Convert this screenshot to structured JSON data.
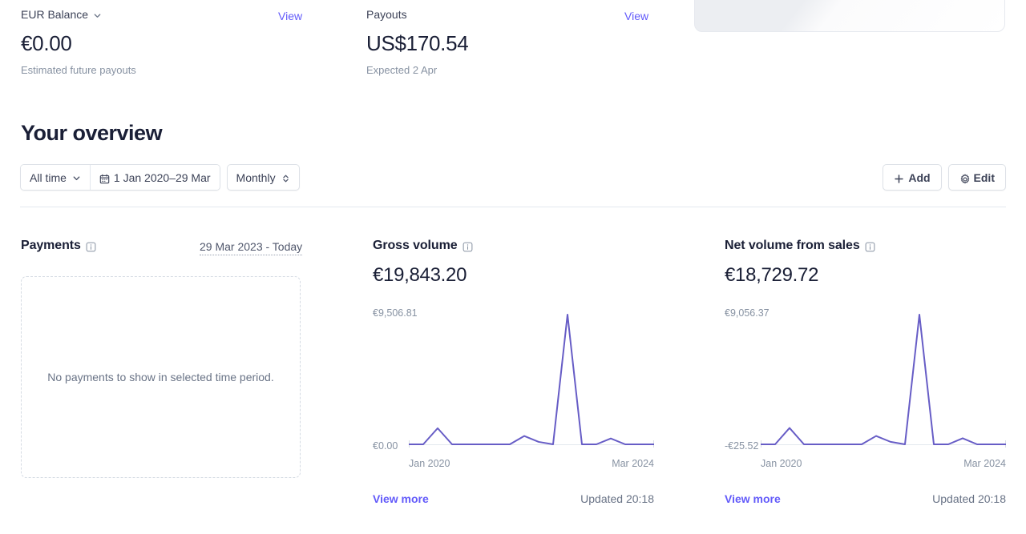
{
  "summary": {
    "balance": {
      "label": "EUR Balance",
      "amount": "€0.00",
      "sub": "Estimated future payouts",
      "view_label": "View",
      "chevron_icon": "chevron-down-icon"
    },
    "payouts": {
      "label": "Payouts",
      "amount": "US$170.54",
      "sub": "Expected 2 Apr",
      "view_label": "View"
    }
  },
  "overview": {
    "title": "Your overview",
    "toolbar": {
      "time_range_label": "All time",
      "date_range_label": "1 Jan 2020–29 Mar",
      "interval_label": "Monthly",
      "calendar_icon": "calendar-icon",
      "chevron_icon": "chevron-down-icon",
      "updown_icon": "chevron-up-down-icon"
    },
    "actions": {
      "add_label": "Add",
      "edit_label": "Edit",
      "plus_icon": "plus-icon",
      "gear_icon": "gear-icon"
    }
  },
  "payments": {
    "title": "Payments",
    "info_icon": "info-icon",
    "range_label": "29 Mar 2023 - Today",
    "empty_text": "No payments to show in selected time period."
  },
  "metrics": [
    {
      "id": "gross-volume",
      "title": "Gross volume",
      "info_icon": "info-icon",
      "value": "€19,843.20",
      "view_more_label": "View more",
      "updated_label": "Updated 20:18"
    },
    {
      "id": "net-volume-from-sales",
      "title": "Net volume from sales",
      "info_icon": "info-icon",
      "value": "€18,729.72",
      "view_more_label": "View more",
      "updated_label": "Updated 20:18"
    }
  ],
  "colors": {
    "brand_link": "#625afa",
    "chart_line": "#675dc6",
    "text_primary": "#1a1f36",
    "text_muted": "#8792a2",
    "border": "#e3e8ee"
  },
  "chart_data": [
    {
      "type": "line",
      "id": "gross-volume",
      "title": "Gross volume",
      "total": 19843.2,
      "ylabel": "",
      "xlabel": "",
      "ylim": [
        0,
        9506.81
      ],
      "ymax_label": "€9,506.81",
      "ymin_label": "€0.00",
      "xticks": [
        "Jan 2020",
        "Mar 2024"
      ],
      "x": [
        "Jan 2020",
        "Apr 2020",
        "Jul 2020",
        "Oct 2020",
        "Jan 2021",
        "Apr 2021",
        "Jul 2021",
        "Oct 2021",
        "Jan 2022",
        "Apr 2022",
        "Jul 2022",
        "Oct 2022",
        "Jan 2023",
        "Apr 2023",
        "Jul 2023",
        "Oct 2023",
        "Jan 2024",
        "Mar 2024"
      ],
      "values": [
        0,
        0,
        1180,
        0,
        0,
        0,
        0,
        0,
        610,
        180,
        0,
        9506.81,
        0,
        0,
        430,
        0,
        0,
        0
      ],
      "grid": false,
      "legend": false
    },
    {
      "type": "line",
      "id": "net-volume-from-sales",
      "title": "Net volume from sales",
      "total": 18729.72,
      "ylabel": "",
      "xlabel": "",
      "ylim": [
        -25.52,
        9056.37
      ],
      "ymax_label": "€9,056.37",
      "ymin_label": "-€25.52",
      "xticks": [
        "Jan 2020",
        "Mar 2024"
      ],
      "x": [
        "Jan 2020",
        "Apr 2020",
        "Jul 2020",
        "Oct 2020",
        "Jan 2021",
        "Apr 2021",
        "Jul 2021",
        "Oct 2021",
        "Jan 2022",
        "Apr 2022",
        "Jul 2022",
        "Oct 2022",
        "Jan 2023",
        "Apr 2023",
        "Jul 2023",
        "Oct 2023",
        "Jan 2024",
        "Mar 2024"
      ],
      "values": [
        -25.52,
        -25.52,
        1120,
        -25.52,
        -25.52,
        -25.52,
        -25.52,
        -25.52,
        560,
        150,
        -25.52,
        9056.37,
        -25.52,
        -25.52,
        400,
        -25.52,
        -25.52,
        -25.52
      ],
      "grid": false,
      "legend": false
    }
  ]
}
